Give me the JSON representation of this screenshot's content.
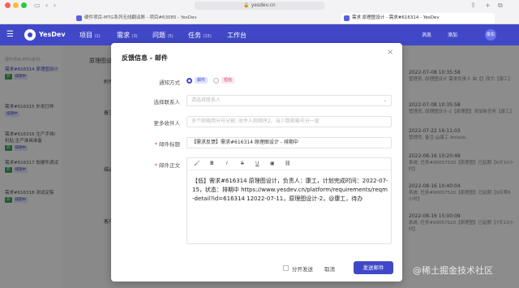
{
  "browser": {
    "url": "yesdev.cn",
    "tabs": [
      {
        "label": "硬件项目-MTG系列无线翻译屏 - 项目#63085 - YesDev",
        "active": false
      },
      {
        "label": "需求 原理图设计 - 需求#616314 - YesDev",
        "active": true
      }
    ],
    "colors": {
      "close": "#fe5f57",
      "min": "#febc2e",
      "max": "#28c840"
    }
  },
  "app": {
    "brand": "YesDev",
    "nav": [
      {
        "label": "项目",
        "count": "(1)"
      },
      {
        "label": "需求",
        "count": "(3)",
        "active": true
      },
      {
        "label": "问题",
        "count": "(5)"
      },
      {
        "label": "任务",
        "count": "(15)"
      },
      {
        "label": "工作台",
        "count": ""
      }
    ],
    "header_right": [
      "消息",
      "添加"
    ],
    "avatar": "俊东",
    "accent": "#4048c8"
  },
  "left": {
    "title": "硬件项目-MTG系列...",
    "items": [
      {
        "title": "需求#616314 原理图设计",
        "badges": [
          "开",
          "排期中"
        ],
        "active": true
      },
      {
        "title": "需求#616315 外发打样",
        "badges": [
          "排期中"
        ]
      },
      {
        "title": "需求#616316 生产手排/机贴,生产准具准备",
        "badges": [
          "开",
          "排期中"
        ]
      },
      {
        "title": "需求#616317 软硬件调试",
        "badges": [
          "开",
          "排期中"
        ]
      },
      {
        "title": "需求#616318 测试定稿",
        "badges": [
          "开",
          "排期中"
        ]
      }
    ]
  },
  "middle": {
    "header": "原理图设计",
    "sections": [
      "附件",
      "备注",
      "描述",
      "客户"
    ]
  },
  "activity": [
    {
      "date": "2022-07-08 10:35:58",
      "text": "管理员, 原理图设计 需求负责人 由【】改为【康工】"
    },
    {
      "date": "2022-07-08 10:35:58",
      "text": "管理员, 原理图设计-2【原理图】添加新任务【康工】"
    },
    {
      "date": "2022-07-22 16:11:03",
      "text": "管理员, 备注 @康工 Anlaob."
    },
    {
      "date": "2022-08-16 10:20:48",
      "text": "系统, 任务#90057520【原理图】已延期【6天10小时】"
    },
    {
      "date": "2022-08-16 10:40:04",
      "text": "系统, 任务#90057520【原理图】已延期【9天零6小时】"
    },
    {
      "date": "2022-08-16 15:00:09",
      "text": "系统, 任务#90057520【原理图】已延期【7天13小时】"
    }
  ],
  "modal": {
    "title": "反馈信息 - 邮件",
    "notify_label": "通知方式",
    "notify_options": [
      {
        "label": "邮件",
        "selected": true
      },
      {
        "label": "短信",
        "selected": false
      }
    ],
    "contact_label": "选择联系人",
    "contact_placeholder": "请选择联系人",
    "more_label": "更多收件人",
    "more_placeholder": "多个邮箱用分号分割: 收件人和顺序2、当少数邮箱号分一级",
    "subject_label": "邮件标题",
    "subject_value": "【需求反馈】需求#616314 原理图设计 - 排期中",
    "body_label": "邮件正文",
    "toolbar_icons": [
      "format-brush-icon",
      "bold-icon",
      "italic-icon",
      "strikethrough-icon",
      "underline-icon",
      "image-icon",
      "link-icon"
    ],
    "body_text": "【低】需求#616314 原理图设计，负责人：康工，计划完成时间：2022-07-15，状态：排期中 https://www.yesdev.cn/platform/requirements/reqm-detail?id=616314 12022-07-11，原理图设计-2，@康工，待办",
    "separate_label": "分开发送",
    "cancel_label": "取消",
    "send_label": "发送邮件"
  },
  "watermark": "@稀土掘金技术社区"
}
